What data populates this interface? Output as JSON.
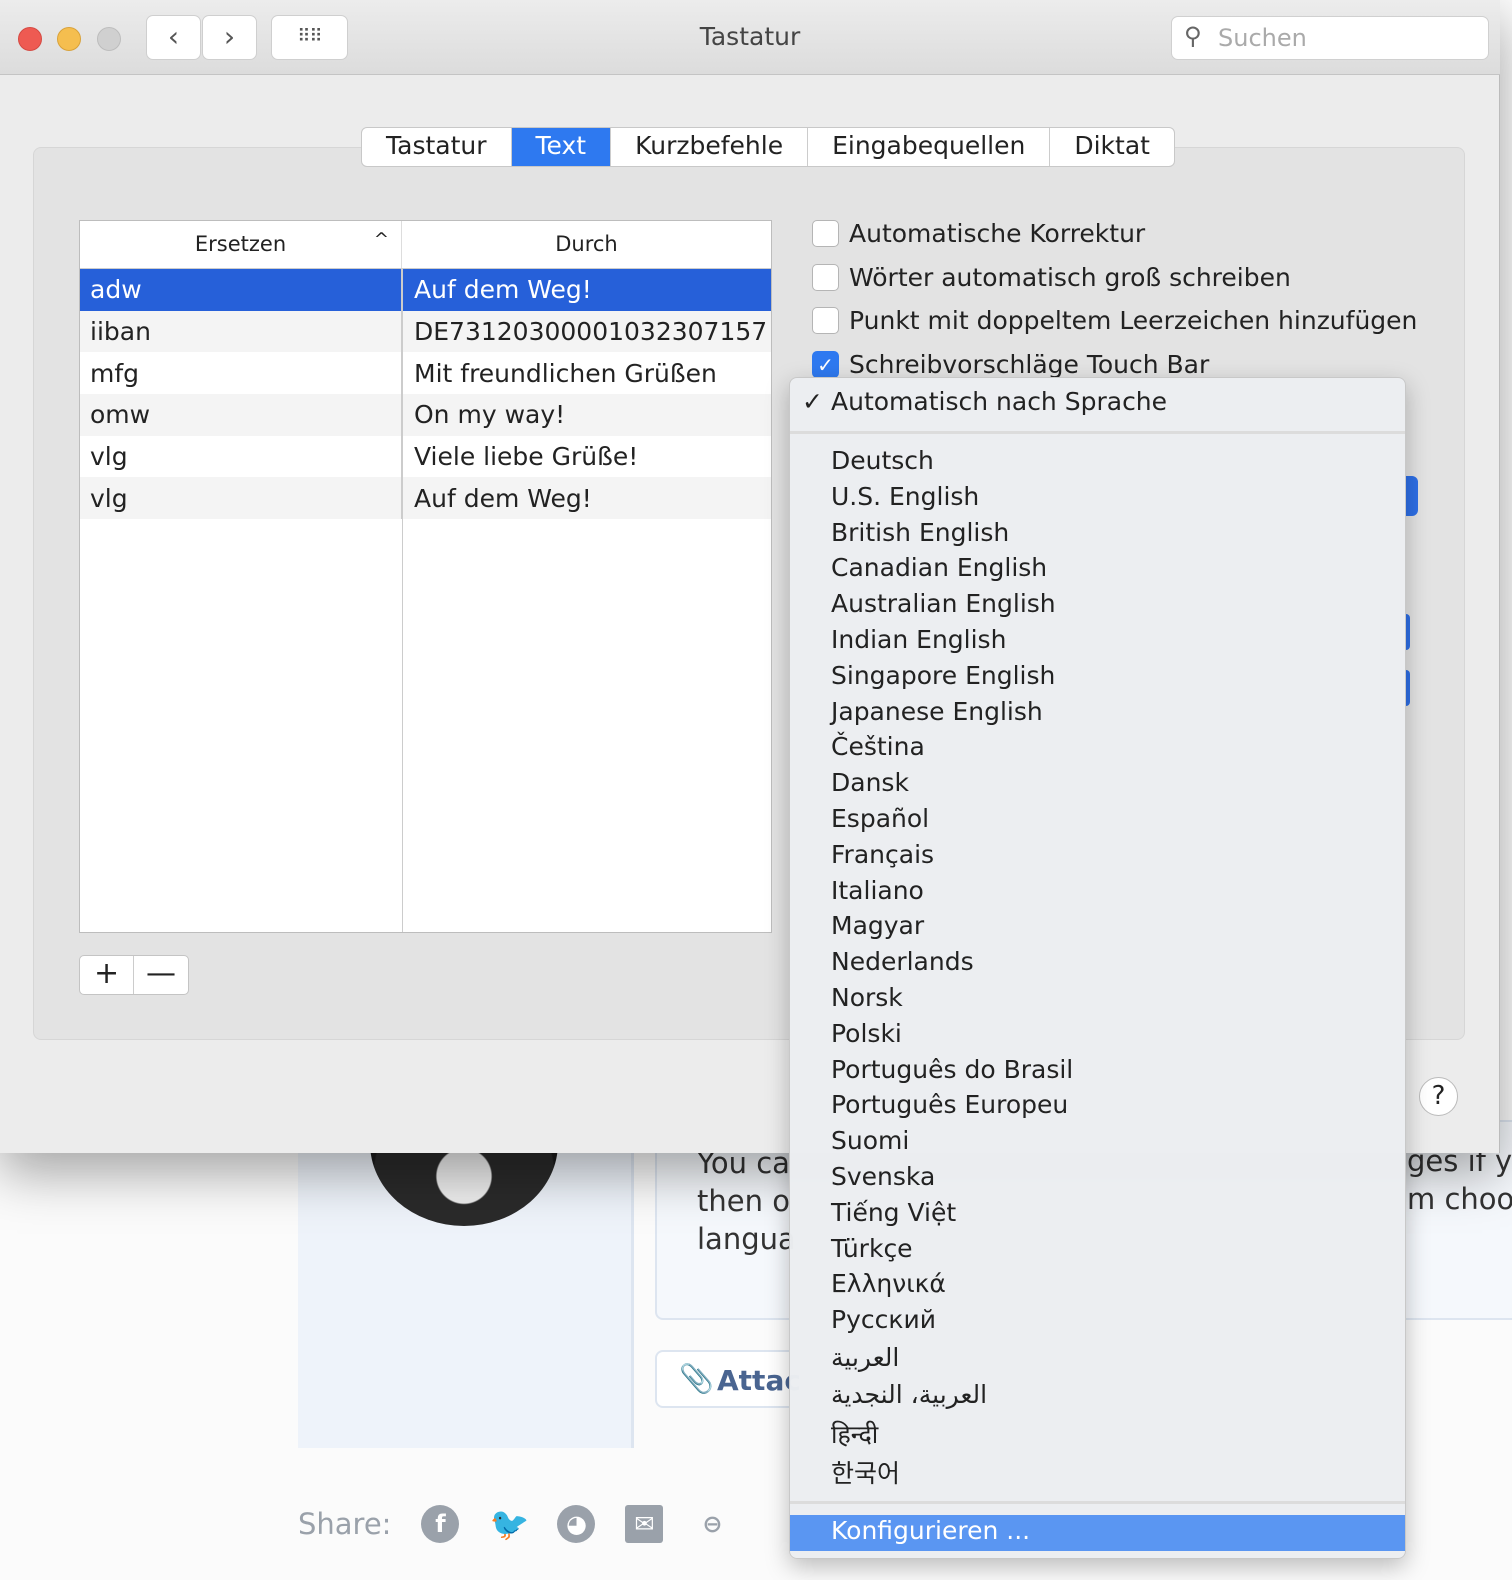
{
  "window": {
    "title": "Tastatur",
    "search_placeholder": "Suchen"
  },
  "tabs": [
    {
      "label": "Tastatur"
    },
    {
      "label": "Text",
      "active": true
    },
    {
      "label": "Kurzbefehle"
    },
    {
      "label": "Eingabequellen"
    },
    {
      "label": "Diktat"
    }
  ],
  "table": {
    "headers": [
      "Ersetzen",
      "Durch"
    ],
    "sort_indicator": "^",
    "rows": [
      {
        "replace": "adw",
        "with": "Auf dem Weg!",
        "selected": true
      },
      {
        "replace": "iiban",
        "with": "DE73120300001032307157"
      },
      {
        "replace": "mfg",
        "with": "Mit freundlichen Grüßen"
      },
      {
        "replace": "omw",
        "with": "On my way!"
      },
      {
        "replace": "vlg",
        "with": "Viele liebe Grüße!"
      },
      {
        "replace": "vlg",
        "with": "Auf dem Weg!"
      }
    ]
  },
  "buttons": {
    "add": "+",
    "remove": "—",
    "help": "?"
  },
  "checkboxes": [
    {
      "label": "Automatische Korrektur",
      "checked": false
    },
    {
      "label": "Wörter automatisch groß schreiben",
      "checked": false
    },
    {
      "label": "Punkt mit doppeltem Leerzeichen hinzufügen",
      "checked": false
    },
    {
      "label": "Schreibvorschläge Touch Bar",
      "checked": true
    }
  ],
  "menu": {
    "checkmark": "✓",
    "selected": "Automatisch nach Sprache",
    "languages": [
      "Deutsch",
      "U.S. English",
      "British English",
      "Canadian English",
      "Australian English",
      "Indian English",
      "Singapore English",
      "Japanese English",
      "Čeština",
      "Dansk",
      "Español",
      "Français",
      "Italiano",
      "Magyar",
      "Nederlands",
      "Norsk",
      "Polski",
      "Português do Brasil",
      "Português Europeu",
      "Suomi",
      "Svenska",
      "Tiếng Việt",
      "Türkçe",
      "Ελληνικά",
      "Русский",
      "العربية",
      "العربية، النجدية",
      "हिन्दी",
      "한국어"
    ],
    "configure": "Konfigurieren ..."
  },
  "background": {
    "text_lines": [
      "You ca",
      "then o",
      "langua"
    ],
    "text_right": [
      "ges if yo",
      "m choo"
    ],
    "attach": "Attac",
    "share_label": "Share:",
    "share_icons": [
      "facebook-icon",
      "twitter-icon",
      "reddit-icon",
      "mail-icon",
      "link-icon"
    ]
  },
  "colors": {
    "accent": "#2e79f0",
    "selection": "#2660d9",
    "menu_highlight": "#5a96f2"
  }
}
